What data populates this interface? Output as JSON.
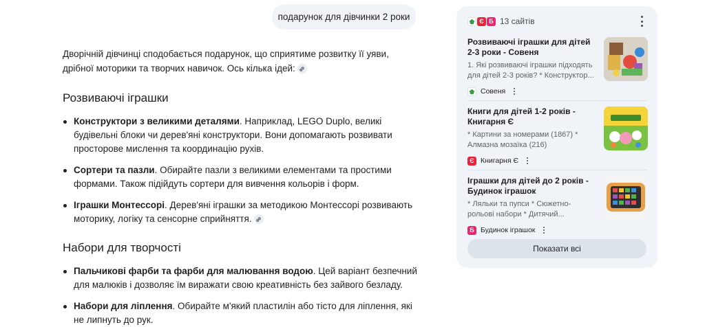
{
  "user_query": "подарунок для дівчинки 2 роки",
  "answer": {
    "intro": "Дворічній дівчинці сподобається подарунок, що сприятиме розвитку її уяви, дрібної моторики та творчих навичок. Ось кілька ідей:",
    "sections": [
      {
        "title": "Розвиваючі іграшки",
        "items": [
          {
            "bold": "Конструктори з великими деталями",
            "text": ". Наприклад, LEGO Duplo, великі будівельні блоки чи дерев'яні конструктори. Вони допомагають розвивати просторове мислення та координацію рухів."
          },
          {
            "bold": "Сортери та пазли",
            "text": ". Обирайте пазли з великими елементами та простими формами. Також підійдуть сортери для вивчення кольорів і форм."
          },
          {
            "bold": "Іграшки Монтессорі",
            "text": ". Дерев'яні іграшки за методикою Монтессорі розвивають моторику, логіку та сенсорне сприйняття."
          }
        ]
      },
      {
        "title": "Набори для творчості",
        "items": [
          {
            "bold": "Пальчикові фарби та фарби для малювання водою",
            "text": ". Цей варіант безпечний для малюків і дозволяє їм виражати свою креативність без зайвого безладу."
          },
          {
            "bold": "Набори для ліплення",
            "text": ". Обирайте м'який пластилін або тісто для ліплення, які не липнуть до рук."
          }
        ]
      }
    ]
  },
  "sources_panel": {
    "count_label": "13 сайтів",
    "favicons": [
      "sovenia-icon",
      "knyharnia-ye-icon",
      "budynok-ihrashok-icon"
    ],
    "knyharnia_glyph": "Є",
    "budynok_glyph": "Б",
    "cards": [
      {
        "title": "Розвиваючі іграшки для дітей 2-3 роки - Совеня",
        "snippet": "1. Які розвиваючі іграшки підходять для дітей 2-3 років? * Конструктор...",
        "source": "Совеня",
        "thumb": "toys-photo"
      },
      {
        "title": "Книги для дітей 1-2 років - Книгарня Є",
        "snippet": "* Картини за номерами (1867) * Алмазна мозаїка (216)",
        "source": "Книгарня Є",
        "thumb": "kids-book-cover"
      },
      {
        "title": "Іграшки для дітей до 2 років - Будинок іграшок",
        "snippet": "* Ляльки та пупси * Сюжетно-рольові набори * Дитячий...",
        "source": "Будинок іграшок",
        "thumb": "toy-tablet"
      }
    ],
    "show_all_label": "Показати всі"
  },
  "colors": {
    "panel_bg": "#f0f4f9",
    "bubble_bg": "#f0f4f9",
    "knyharnia_red": "#e8233b",
    "budynok_pink": "#e6266e",
    "sovenia_green": "#3a9a4a"
  }
}
